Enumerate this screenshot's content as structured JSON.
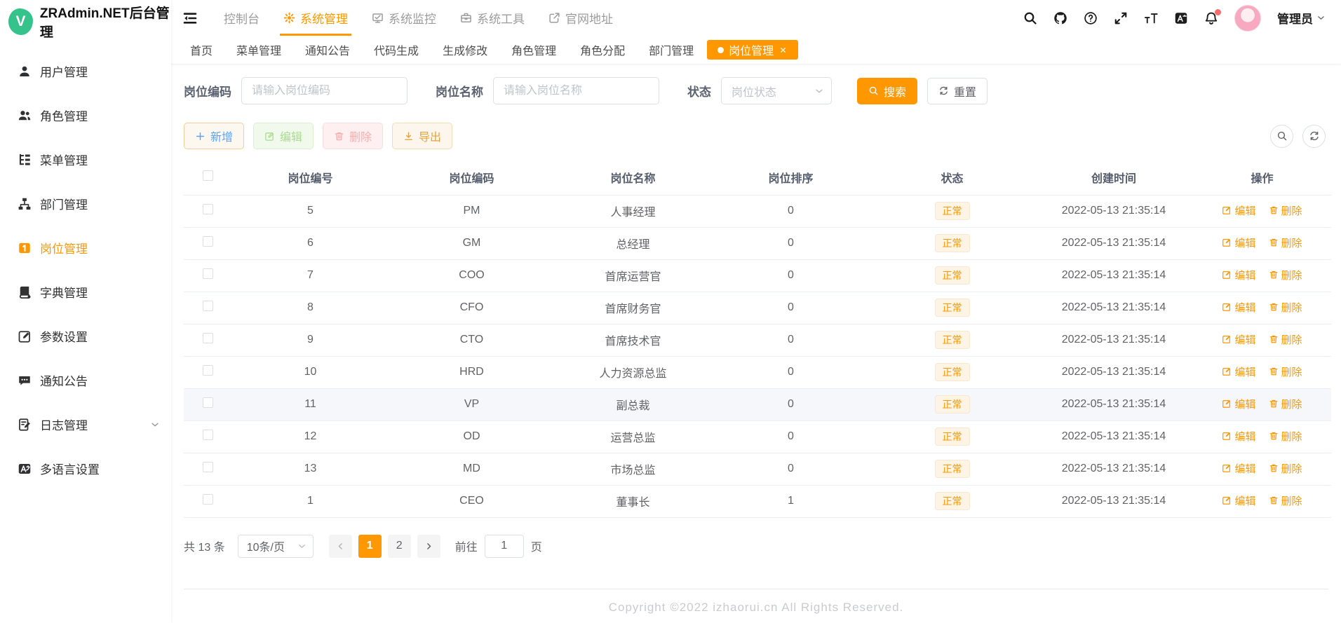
{
  "app": {
    "title": "ZRAdmin.NET后台管理",
    "footer": "Copyright ©2022 izhaorui.cn All Rights Reserved."
  },
  "colors": {
    "accent": "#ff9700",
    "success_badge_bg": "#fdf4e6",
    "danger": "#f56c6c",
    "logo_green": "#35c28b"
  },
  "sidebar": {
    "items": [
      {
        "label": "用户管理",
        "icon": "user-icon",
        "active": false
      },
      {
        "label": "角色管理",
        "icon": "users-icon",
        "active": false
      },
      {
        "label": "菜单管理",
        "icon": "menu-tree-icon",
        "active": false
      },
      {
        "label": "部门管理",
        "icon": "org-icon",
        "active": false
      },
      {
        "label": "岗位管理",
        "icon": "post-icon",
        "active": true
      },
      {
        "label": "字典管理",
        "icon": "dict-icon",
        "active": false
      },
      {
        "label": "参数设置",
        "icon": "edit-square-icon",
        "active": false
      },
      {
        "label": "通知公告",
        "icon": "chat-icon",
        "active": false
      },
      {
        "label": "日志管理",
        "icon": "log-icon",
        "active": false,
        "expandable": true
      },
      {
        "label": "多语言设置",
        "icon": "i18n-icon",
        "active": false
      }
    ]
  },
  "topnav": {
    "items": [
      {
        "label": "控制台",
        "icon": null,
        "active": false
      },
      {
        "label": "系统管理",
        "icon": "gear-icon",
        "active": true
      },
      {
        "label": "系统监控",
        "icon": "monitor-icon",
        "active": false
      },
      {
        "label": "系统工具",
        "icon": "toolbox-icon",
        "active": false
      },
      {
        "label": "官网地址",
        "icon": "external-link-icon",
        "active": false
      }
    ],
    "tools": [
      {
        "icon": "search-icon"
      },
      {
        "icon": "github-icon"
      },
      {
        "icon": "help-icon"
      },
      {
        "icon": "fullscreen-icon"
      },
      {
        "icon": "font-size-icon"
      },
      {
        "icon": "language-icon"
      },
      {
        "icon": "bell-icon",
        "badge": true
      }
    ],
    "user": {
      "name": "管理员"
    }
  },
  "tabs": [
    {
      "label": "首页",
      "active": false,
      "closable": false
    },
    {
      "label": "菜单管理",
      "active": false,
      "closable": false
    },
    {
      "label": "通知公告",
      "active": false,
      "closable": false
    },
    {
      "label": "代码生成",
      "active": false,
      "closable": false
    },
    {
      "label": "生成修改",
      "active": false,
      "closable": false
    },
    {
      "label": "角色管理",
      "active": false,
      "closable": false
    },
    {
      "label": "角色分配",
      "active": false,
      "closable": false
    },
    {
      "label": "部门管理",
      "active": false,
      "closable": false
    },
    {
      "label": "岗位管理",
      "active": true,
      "closable": true
    }
  ],
  "filters": {
    "code": {
      "label": "岗位编码",
      "placeholder": "请输入岗位编码",
      "value": ""
    },
    "name": {
      "label": "岗位名称",
      "placeholder": "请输入岗位名称",
      "value": ""
    },
    "status": {
      "label": "状态",
      "placeholder": "岗位状态"
    },
    "search_label": "搜索",
    "reset_label": "重置"
  },
  "toolbar": {
    "add_label": "新增",
    "edit_label": "编辑",
    "delete_label": "删除",
    "export_label": "导出"
  },
  "table": {
    "columns": [
      "岗位编号",
      "岗位编码",
      "岗位名称",
      "岗位排序",
      "状态",
      "创建时间",
      "操作"
    ],
    "actions": {
      "edit": "编辑",
      "delete": "删除"
    },
    "rows": [
      {
        "id": "5",
        "code": "PM",
        "name": "人事经理",
        "sort": "0",
        "status": "正常",
        "created": "2022-05-13 21:35:14",
        "highlighted": false
      },
      {
        "id": "6",
        "code": "GM",
        "name": "总经理",
        "sort": "0",
        "status": "正常",
        "created": "2022-05-13 21:35:14",
        "highlighted": false
      },
      {
        "id": "7",
        "code": "COO",
        "name": "首席运营官",
        "sort": "0",
        "status": "正常",
        "created": "2022-05-13 21:35:14",
        "highlighted": false
      },
      {
        "id": "8",
        "code": "CFO",
        "name": "首席财务官",
        "sort": "0",
        "status": "正常",
        "created": "2022-05-13 21:35:14",
        "highlighted": false
      },
      {
        "id": "9",
        "code": "CTO",
        "name": "首席技术官",
        "sort": "0",
        "status": "正常",
        "created": "2022-05-13 21:35:14",
        "highlighted": false
      },
      {
        "id": "10",
        "code": "HRD",
        "name": "人力资源总监",
        "sort": "0",
        "status": "正常",
        "created": "2022-05-13 21:35:14",
        "highlighted": false
      },
      {
        "id": "11",
        "code": "VP",
        "name": "副总裁",
        "sort": "0",
        "status": "正常",
        "created": "2022-05-13 21:35:14",
        "highlighted": true
      },
      {
        "id": "12",
        "code": "OD",
        "name": "运营总监",
        "sort": "0",
        "status": "正常",
        "created": "2022-05-13 21:35:14",
        "highlighted": false
      },
      {
        "id": "13",
        "code": "MD",
        "name": "市场总监",
        "sort": "0",
        "status": "正常",
        "created": "2022-05-13 21:35:14",
        "highlighted": false
      },
      {
        "id": "1",
        "code": "CEO",
        "name": "董事长",
        "sort": "1",
        "status": "正常",
        "created": "2022-05-13 21:35:14",
        "highlighted": false
      }
    ]
  },
  "pagination": {
    "total_label": "共 13 条",
    "page_size": "10条/页",
    "pages": [
      {
        "label": "1",
        "active": true
      },
      {
        "label": "2",
        "active": false
      }
    ],
    "goto_label": "前往",
    "goto_value": "1",
    "page_unit": "页"
  }
}
